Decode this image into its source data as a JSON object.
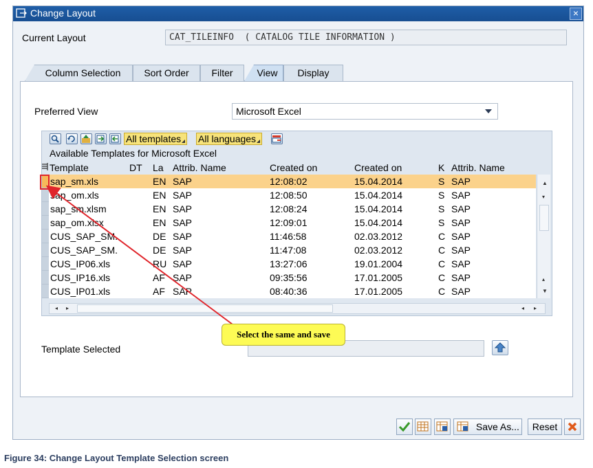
{
  "window": {
    "title": "Change Layout"
  },
  "current_layout": {
    "label": "Current Layout",
    "value": "CAT_TILEINFO  ( CATALOG TILE INFORMATION )"
  },
  "tabs": [
    {
      "label": "Column Selection"
    },
    {
      "label": "Sort Order"
    },
    {
      "label": "Filter"
    },
    {
      "label": "View"
    },
    {
      "label": "Display"
    }
  ],
  "preferred_view": {
    "label": "Preferred View",
    "value": "Microsoft Excel"
  },
  "grid": {
    "toolbar": {
      "all_templates": "All templates",
      "all_languages": "All languages"
    },
    "caption": "Available Templates for Microsoft Excel",
    "columns": [
      "Template",
      "DT",
      "La",
      "Attrib. Name",
      "Created on",
      "Created on",
      "K",
      "Attrib. Name"
    ],
    "rows": [
      {
        "template": "sap_sm.xls",
        "dt": "",
        "la": "EN",
        "attrib": "SAP",
        "time": "12:08:02",
        "date": "15.04.2014",
        "k": "S",
        "attrib2": "SAP",
        "selected": true
      },
      {
        "template": "sap_om.xls",
        "dt": "",
        "la": "EN",
        "attrib": "SAP",
        "time": "12:08:50",
        "date": "15.04.2014",
        "k": "S",
        "attrib2": "SAP"
      },
      {
        "template": "sap_sm.xlsm",
        "dt": "",
        "la": "EN",
        "attrib": "SAP",
        "time": "12:08:24",
        "date": "15.04.2014",
        "k": "S",
        "attrib2": "SAP"
      },
      {
        "template": "sap_om.xlsx",
        "dt": "",
        "la": "EN",
        "attrib": "SAP",
        "time": "12:09:01",
        "date": "15.04.2014",
        "k": "S",
        "attrib2": "SAP"
      },
      {
        "template": "CUS_SAP_SM.",
        "dt": "",
        "la": "DE",
        "attrib": "SAP",
        "time": "11:46:58",
        "date": "02.03.2012",
        "k": "C",
        "attrib2": "SAP"
      },
      {
        "template": "CUS_SAP_SM.",
        "dt": "",
        "la": "DE",
        "attrib": "SAP",
        "time": "11:47:08",
        "date": "02.03.2012",
        "k": "C",
        "attrib2": "SAP"
      },
      {
        "template": "CUS_IP06.xls",
        "dt": "",
        "la": "RU",
        "attrib": "SAP",
        "time": "13:27:06",
        "date": "19.01.2004",
        "k": "C",
        "attrib2": "SAP"
      },
      {
        "template": "CUS_IP16.xls",
        "dt": "",
        "la": "AF",
        "attrib": "SAP",
        "time": "09:35:56",
        "date": "17.01.2005",
        "k": "C",
        "attrib2": "SAP"
      },
      {
        "template": "CUS_IP01.xls",
        "dt": "",
        "la": "AF",
        "attrib": "SAP",
        "time": "08:40:36",
        "date": "17.01.2005",
        "k": "C",
        "attrib2": "SAP"
      }
    ]
  },
  "template_selected": {
    "label": "Template Selected",
    "value": ""
  },
  "callout": {
    "text": "Select the same and save"
  },
  "buttons": {
    "save_as": "Save As...",
    "reset": "Reset"
  },
  "caption": "Figure 34: Change Layout Template Selection screen",
  "colors": {
    "titlebar": "#1f5ea8",
    "selected_row": "#fbd28b",
    "callout": "#fdfb55",
    "arrow": "#e0252b"
  }
}
